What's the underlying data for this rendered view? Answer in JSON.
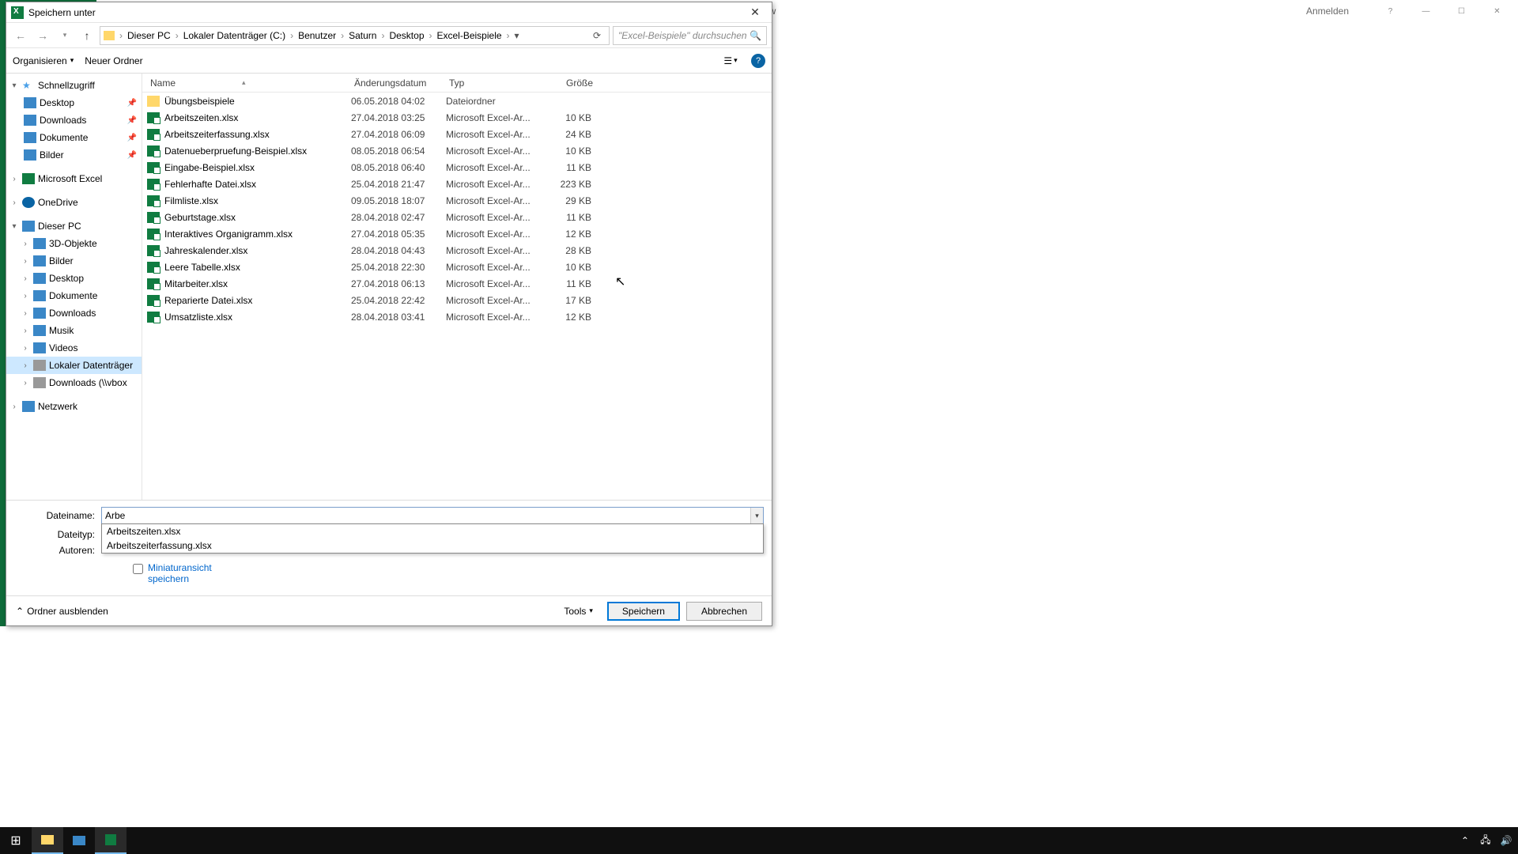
{
  "excel_bg": {
    "title": "Preview",
    "signin": "Anmelden"
  },
  "dialog": {
    "title": "Speichern unter",
    "breadcrumb": [
      "Dieser PC",
      "Lokaler Datenträger (C:)",
      "Benutzer",
      "Saturn",
      "Desktop",
      "Excel-Beispiele"
    ],
    "search_placeholder": "\"Excel-Beispiele\" durchsuchen",
    "toolbar": {
      "organize": "Organisieren",
      "new_folder": "Neuer Ordner"
    },
    "tree": {
      "quick": "Schnellzugriff",
      "desktop": "Desktop",
      "downloads": "Downloads",
      "documents": "Dokumente",
      "pictures": "Bilder",
      "excel": "Microsoft Excel",
      "onedrive": "OneDrive",
      "thispc": "Dieser PC",
      "objects3d": "3D-Objekte",
      "pictures2": "Bilder",
      "desktop2": "Desktop",
      "documents2": "Dokumente",
      "downloads2": "Downloads",
      "music": "Musik",
      "videos": "Videos",
      "localdisk": "Lokaler Datenträger",
      "vbox": "Downloads (\\\\vbox",
      "network": "Netzwerk"
    },
    "columns": {
      "name": "Name",
      "date": "Änderungsdatum",
      "type": "Typ",
      "size": "Größe"
    },
    "files": [
      {
        "name": "Übungsbeispiele",
        "date": "06.05.2018 04:02",
        "type": "Dateiordner",
        "size": "",
        "folder": true
      },
      {
        "name": "Arbeitszeiten.xlsx",
        "date": "27.04.2018 03:25",
        "type": "Microsoft Excel-Ar...",
        "size": "10 KB"
      },
      {
        "name": "Arbeitszeiterfassung.xlsx",
        "date": "27.04.2018 06:09",
        "type": "Microsoft Excel-Ar...",
        "size": "24 KB"
      },
      {
        "name": "Datenueberpruefung-Beispiel.xlsx",
        "date": "08.05.2018 06:54",
        "type": "Microsoft Excel-Ar...",
        "size": "10 KB"
      },
      {
        "name": "Eingabe-Beispiel.xlsx",
        "date": "08.05.2018 06:40",
        "type": "Microsoft Excel-Ar...",
        "size": "11 KB"
      },
      {
        "name": "Fehlerhafte Datei.xlsx",
        "date": "25.04.2018 21:47",
        "type": "Microsoft Excel-Ar...",
        "size": "223 KB"
      },
      {
        "name": "Filmliste.xlsx",
        "date": "09.05.2018 18:07",
        "type": "Microsoft Excel-Ar...",
        "size": "29 KB"
      },
      {
        "name": "Geburtstage.xlsx",
        "date": "28.04.2018 02:47",
        "type": "Microsoft Excel-Ar...",
        "size": "11 KB"
      },
      {
        "name": "Interaktives Organigramm.xlsx",
        "date": "27.04.2018 05:35",
        "type": "Microsoft Excel-Ar...",
        "size": "12 KB"
      },
      {
        "name": "Jahreskalender.xlsx",
        "date": "28.04.2018 04:43",
        "type": "Microsoft Excel-Ar...",
        "size": "28 KB"
      },
      {
        "name": "Leere Tabelle.xlsx",
        "date": "25.04.2018 22:30",
        "type": "Microsoft Excel-Ar...",
        "size": "10 KB"
      },
      {
        "name": "Mitarbeiter.xlsx",
        "date": "27.04.2018 06:13",
        "type": "Microsoft Excel-Ar...",
        "size": "11 KB"
      },
      {
        "name": "Reparierte Datei.xlsx",
        "date": "25.04.2018 22:42",
        "type": "Microsoft Excel-Ar...",
        "size": "17 KB"
      },
      {
        "name": "Umsatzliste.xlsx",
        "date": "28.04.2018 03:41",
        "type": "Microsoft Excel-Ar...",
        "size": "12 KB"
      }
    ],
    "fields": {
      "filename_label": "Dateiname:",
      "filename_value": "Arbe",
      "filetype_label": "Dateityp:",
      "authors_label": "Autoren:",
      "autocomplete": [
        "Arbeitszeiten.xlsx",
        "Arbeitszeiterfassung.xlsx"
      ],
      "thumb_checkbox": "Miniaturansicht speichern"
    },
    "footer": {
      "hide_folders": "Ordner ausblenden",
      "tools": "Tools",
      "save": "Speichern",
      "cancel": "Abbrechen"
    }
  }
}
